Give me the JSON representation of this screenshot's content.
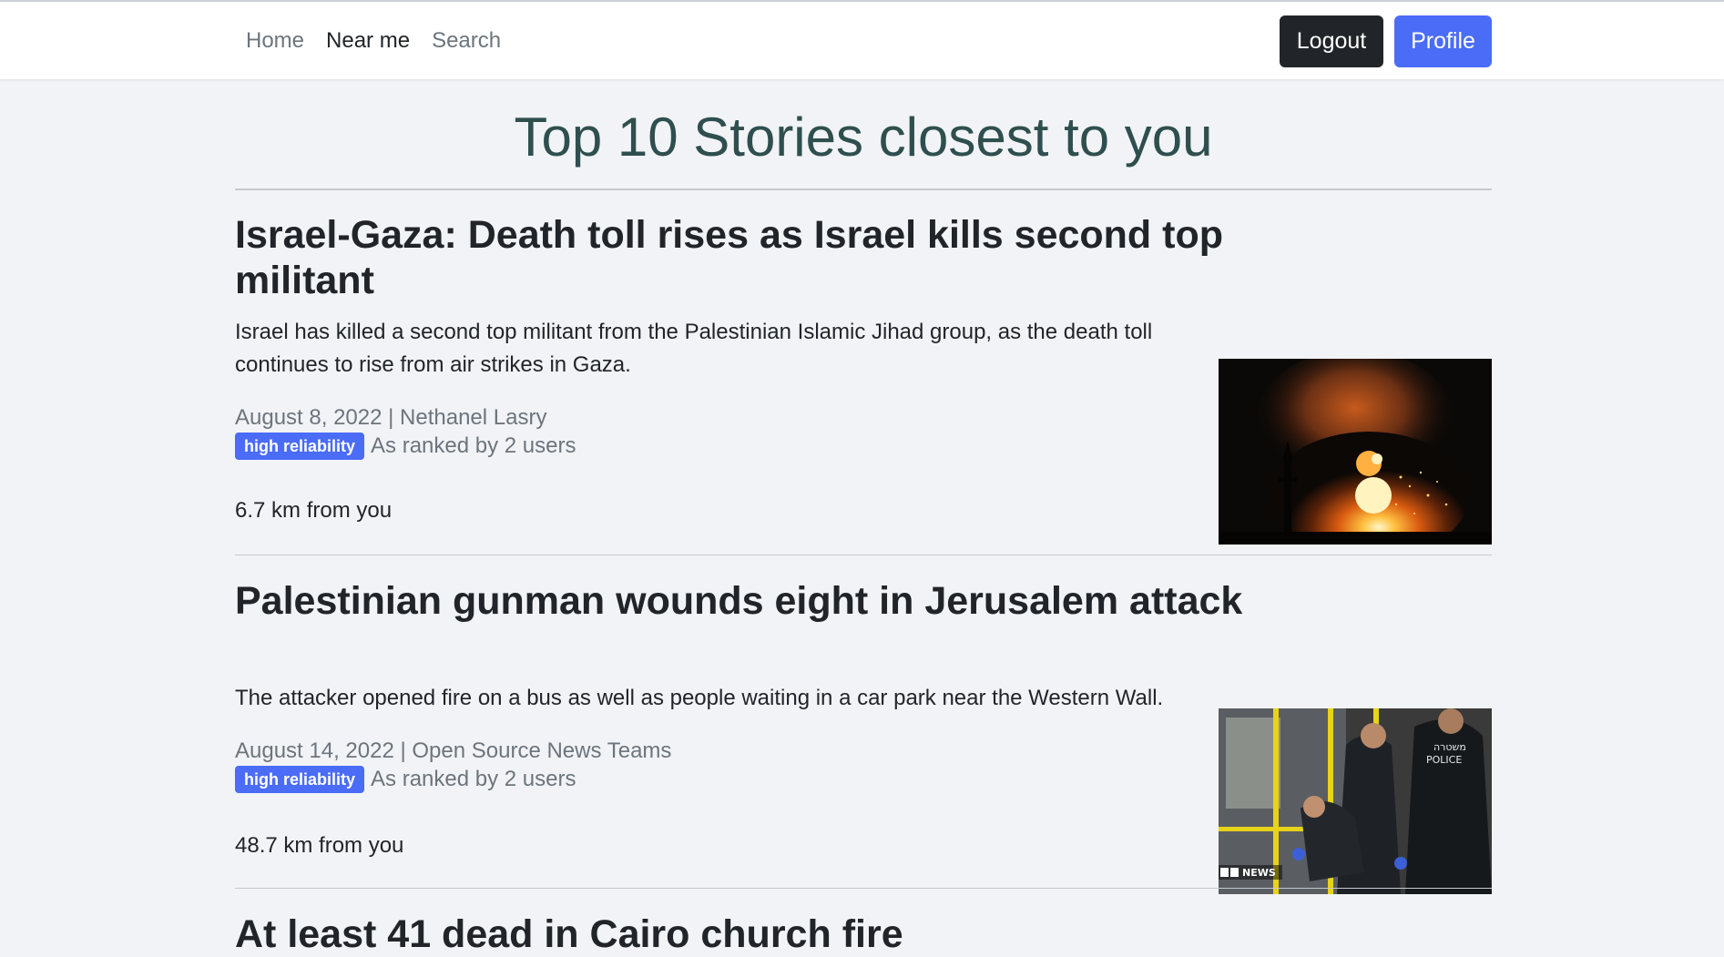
{
  "nav": {
    "links": [
      "Home",
      "Near me",
      "Search"
    ],
    "logout_label": "Logout",
    "profile_label": "Profile"
  },
  "page_title": "Top 10 Stories closest to you",
  "stories": [
    {
      "title": "Israel-Gaza: Death toll rises as Israel kills second top militant",
      "description": "Israel has killed a second top militant from the Palestinian Islamic Jihad group, as the death toll continues to rise from air strikes in Gaza.",
      "meta": "August 8, 2022 | Nethanel Lasry",
      "badge": "high reliability",
      "ranking": "As ranked by 2 users",
      "distance": "6.7 km from you"
    },
    {
      "title": "Palestinian gunman wounds eight in Jerusalem attack",
      "description": "The attacker opened fire on a bus as well as people waiting in a car park near the Western Wall.",
      "meta": "August 14, 2022 | Open Source News Teams",
      "badge": "high reliability",
      "ranking": "As ranked by 2 users",
      "distance": "48.7 km from you",
      "image_overlay_text": "B C NEWS",
      "image_vest_text": "משטרה POLICE"
    },
    {
      "title": "At least 41 dead in Cairo church fire"
    }
  ],
  "colors": {
    "primary": "#4a6cf7",
    "dark": "#212529",
    "title": "#2f4f4f",
    "background": "#f2f3f6"
  }
}
